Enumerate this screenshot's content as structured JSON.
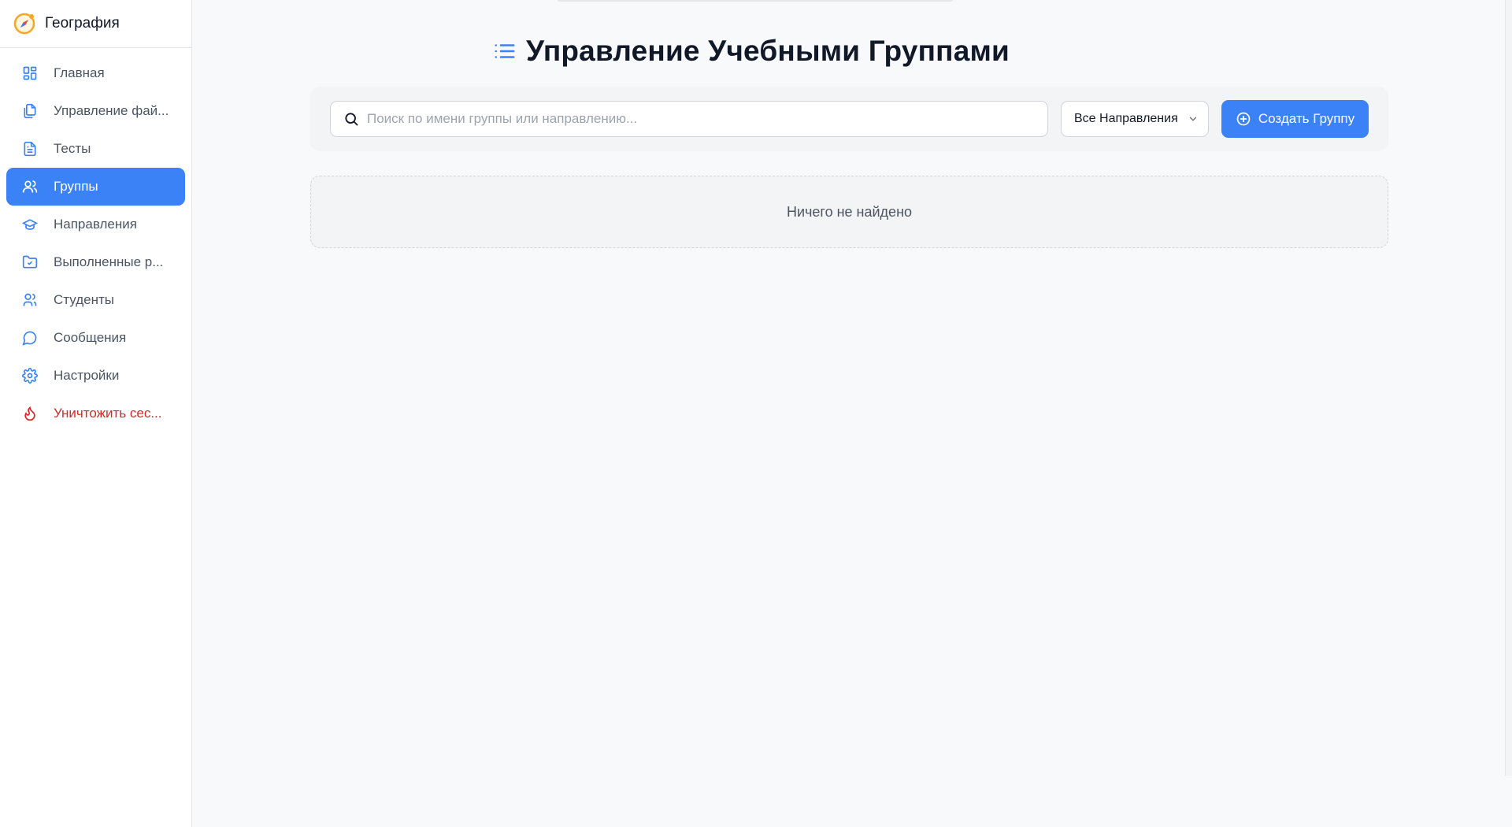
{
  "app": {
    "title": "География",
    "brand_icon": "compass-icon"
  },
  "sidebar": {
    "items": [
      {
        "label": "Главная",
        "icon": "dashboard-icon"
      },
      {
        "label": "Управление фай...",
        "icon": "files-icon"
      },
      {
        "label": "Тесты",
        "icon": "document-icon"
      },
      {
        "label": "Группы",
        "icon": "users-icon",
        "active": true
      },
      {
        "label": "Направления",
        "icon": "graduation-cap-icon"
      },
      {
        "label": "Выполненные р...",
        "icon": "folder-check-icon"
      },
      {
        "label": "Студенты",
        "icon": "students-icon"
      },
      {
        "label": "Сообщения",
        "icon": "chat-icon"
      },
      {
        "label": "Настройки",
        "icon": "gear-icon"
      },
      {
        "label": "Уничтожить сес...",
        "icon": "flame-icon",
        "danger": true
      }
    ]
  },
  "main": {
    "title": "Управление Учебными Группами",
    "title_icon": "list-icon",
    "search": {
      "placeholder": "Поиск по имени группы или направлению...",
      "value": ""
    },
    "filter": {
      "selected": "Все Направления"
    },
    "create_button": {
      "label": "Создать Группу"
    },
    "empty_state": "Ничего не найдено"
  },
  "colors": {
    "accent": "#3b82f6",
    "danger": "#dc2626",
    "background": "#f8f9fb"
  }
}
